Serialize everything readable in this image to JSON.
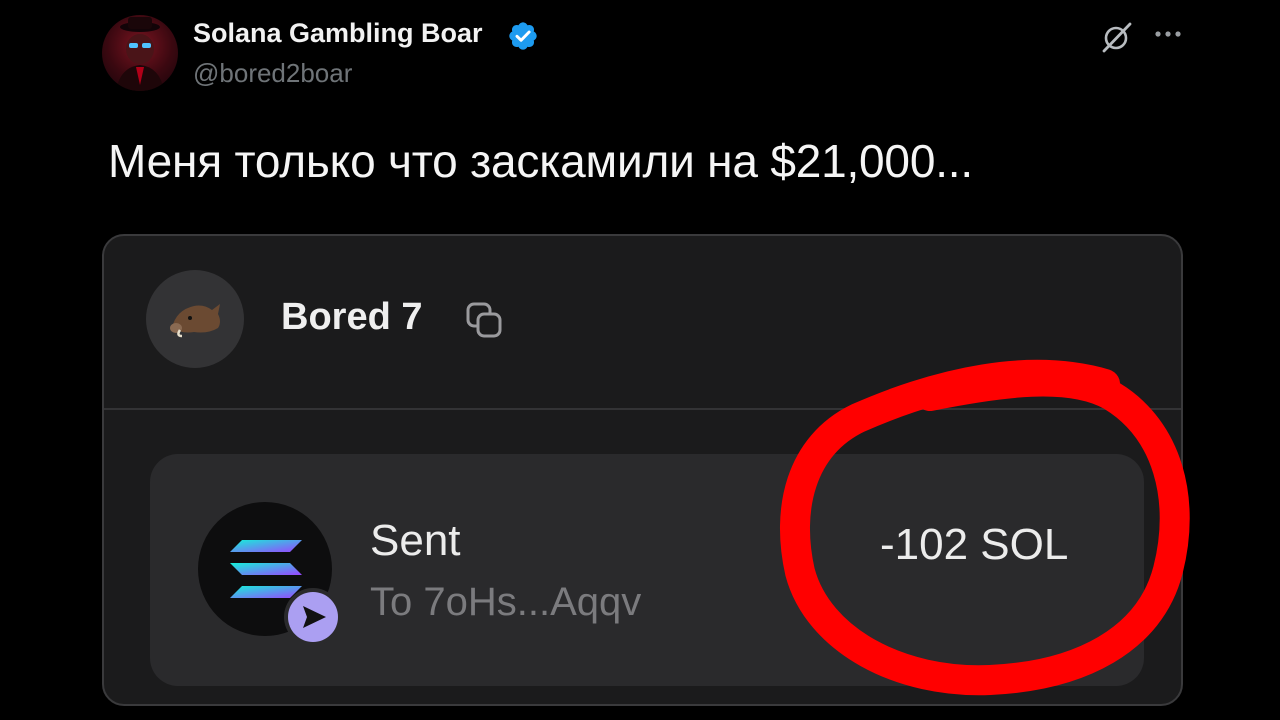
{
  "post": {
    "author_name": "Solana Gambling Boar",
    "handle": "@bored2boar",
    "text": "Меня только что заскамили на $21,000..."
  },
  "wallet": {
    "name": "Bored 7"
  },
  "transaction": {
    "title": "Sent",
    "recipient": "To 7oHs...Aqqv",
    "amount": "-102 SOL"
  },
  "icons": {
    "verified": "verified-badge-icon",
    "grok": "grok-icon",
    "more": "more-options-icon",
    "copy": "copy-icon",
    "token": "solana-logo-icon",
    "send": "send-arrow-icon"
  },
  "colors": {
    "background": "#000000",
    "verified": "#1d9bf0",
    "highlight": "#ff0000",
    "send_badge": "#ab9ff2"
  }
}
